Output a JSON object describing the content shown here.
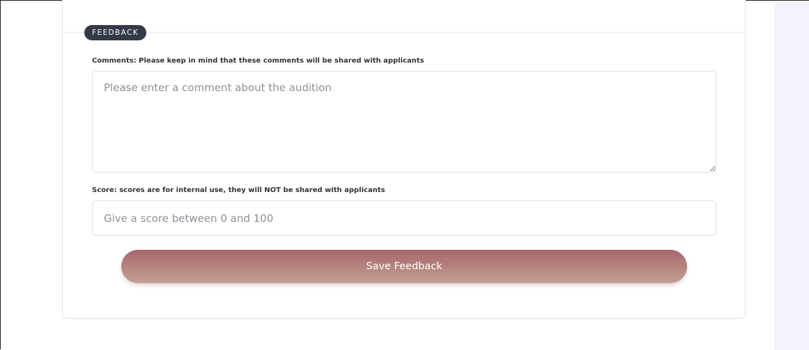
{
  "feedback": {
    "section_title": "FEEDBACK",
    "comments": {
      "label": "Comments: Please keep in mind that these comments will be shared with applicants",
      "placeholder": "Please enter a comment about the audition",
      "value": ""
    },
    "score": {
      "label": "Score: scores are for internal use, they will NOT be shared with applicants",
      "placeholder": "Give a score between 0 and 100",
      "value": ""
    },
    "save_label": "Save Feedback"
  },
  "colors": {
    "section_pill": "#343a48",
    "button_top": "#a8666b",
    "button_bottom": "#c4a094",
    "page_sidebar": "#f3f4fb"
  }
}
